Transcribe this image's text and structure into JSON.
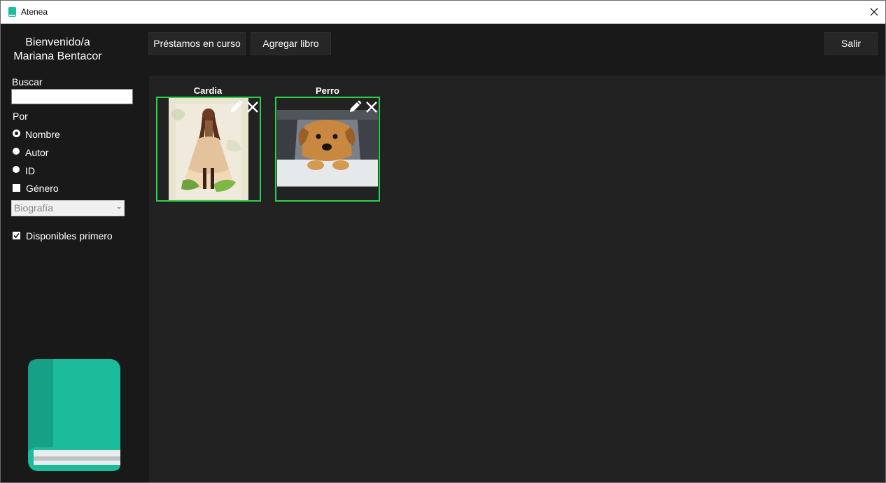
{
  "window": {
    "title": "Atenea"
  },
  "sidebar": {
    "welcome_line1": "Bienvenido/a",
    "welcome_line2": "Mariana Bentacor",
    "search_label": "Buscar",
    "search_value": "",
    "by_label": "Por",
    "radio_options": [
      {
        "label": "Nombre",
        "selected": true
      },
      {
        "label": "Autor",
        "selected": false
      },
      {
        "label": "ID",
        "selected": false
      }
    ],
    "genre_label": "Género",
    "genre_checked": false,
    "genre_select_value": "Biografía",
    "available_first_label": "Disponibles primero",
    "available_first_checked": true
  },
  "toolbar": {
    "loans_label": "Préstamos en curso",
    "add_book_label": "Agregar libro",
    "exit_label": "Salir"
  },
  "books": [
    {
      "title": "Cardia",
      "image": "anime-girl-illustration"
    },
    {
      "title": "Perro",
      "image": "golden-retriever-puppy-in-car"
    }
  ],
  "colors": {
    "accent": "#1abc9c",
    "card_border": "#28d24b",
    "background": "#191919",
    "panel": "#222222"
  }
}
